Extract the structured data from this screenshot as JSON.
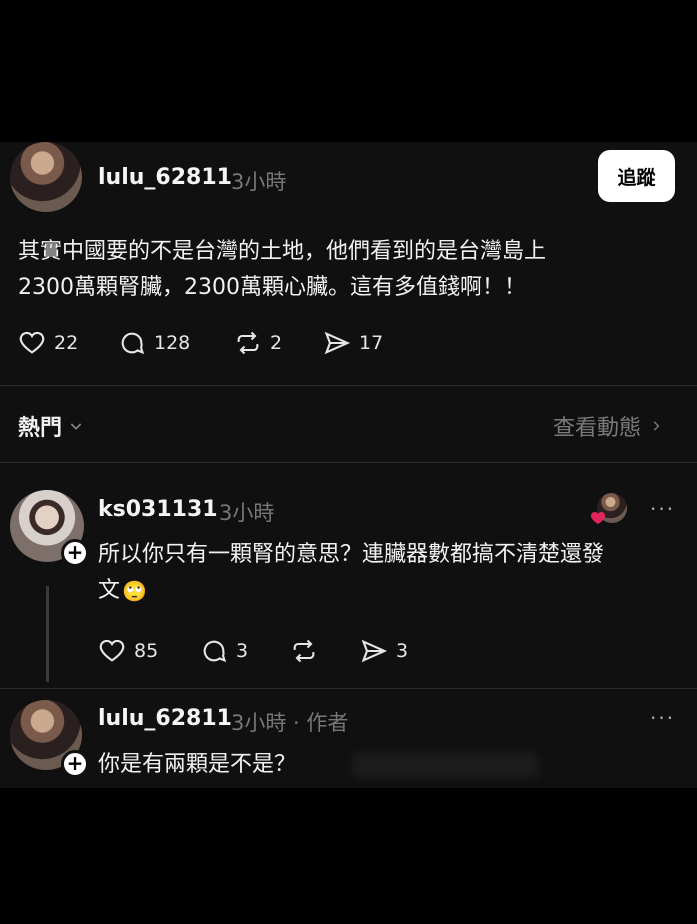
{
  "post": {
    "username": "lulu_62811",
    "time": "3小時",
    "follow_label": "追蹤",
    "line1": "其實中國要的不是台灣的土地，他們看到的是台灣島上",
    "line2": "2300萬顆腎臟，2300萬顆心臟。這有多值錢啊！！",
    "likes": "22",
    "comments": "128",
    "reposts": "2",
    "shares": "17"
  },
  "section": {
    "hot_label": "熱門",
    "view_activity": "查看動態"
  },
  "reply1": {
    "username": "ks031131",
    "time": "3小時",
    "line1": "所以你只有一顆腎的意思？連臟器數都搞不清楚還發",
    "line2": "文",
    "emoji": "🙄",
    "likes": "85",
    "comments": "3",
    "shares": "3",
    "more": "···"
  },
  "reply2": {
    "username": "lulu_62811",
    "time": "3小時 · 作者",
    "text": "你是有兩顆是不是？",
    "more": "···"
  }
}
